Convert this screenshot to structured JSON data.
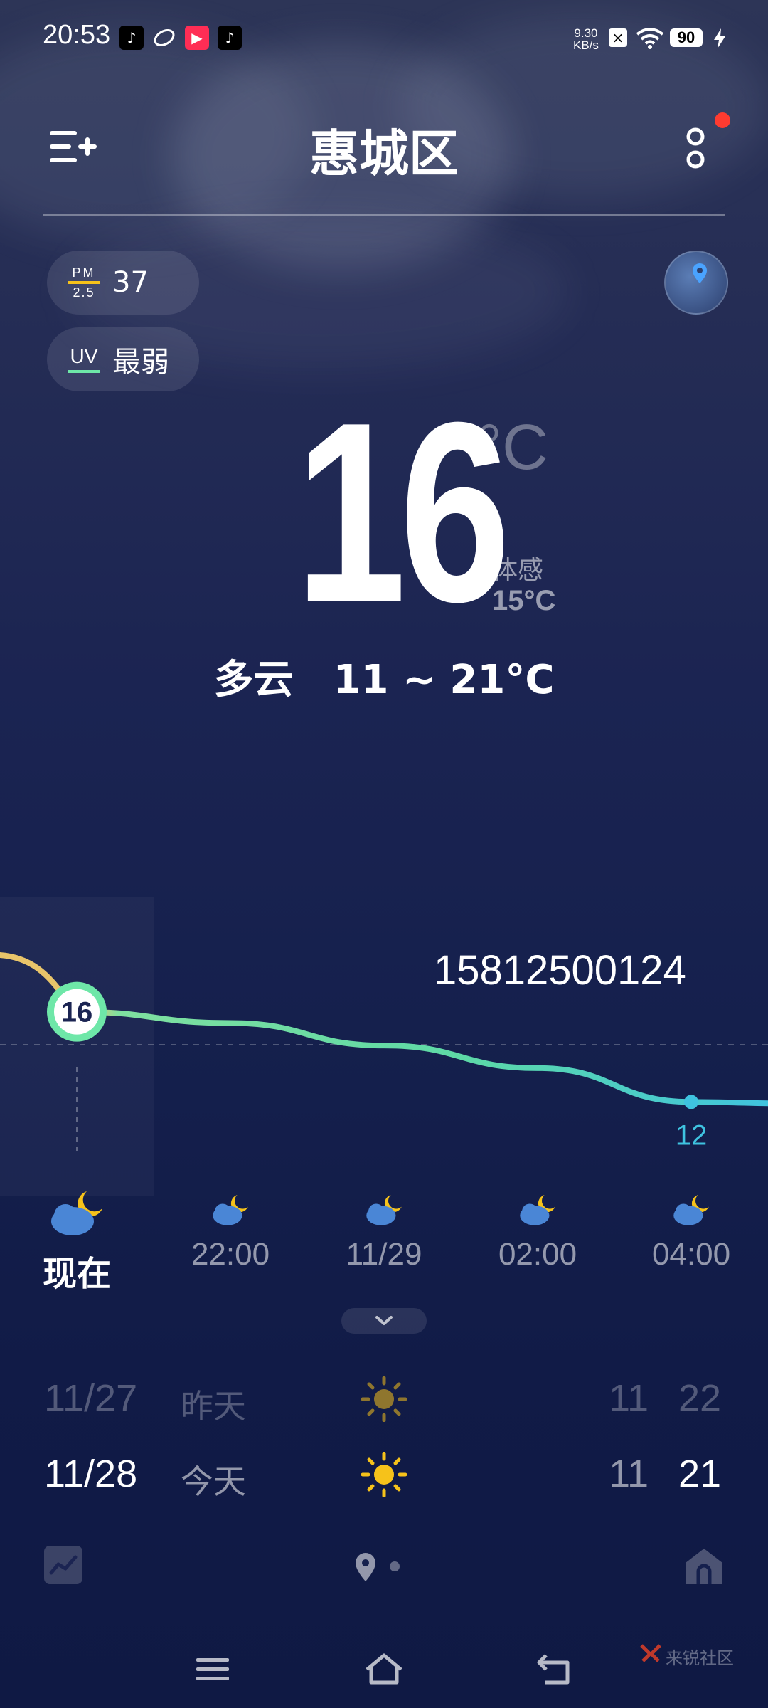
{
  "status_bar": {
    "time": "20:53",
    "network_speed_value": "9.30",
    "network_speed_unit": "KB/s",
    "battery": "90"
  },
  "header": {
    "city": "惠城区"
  },
  "air": {
    "pm_top": "PM",
    "pm_bottom": "2.5",
    "pm_value": "37",
    "uv_label": "UV",
    "uv_value": "最弱"
  },
  "current": {
    "temperature": "16",
    "unit": "°C",
    "feels_label": "体感",
    "feels_value": "15°C",
    "condition_line": "多云　11 ~ 21°C"
  },
  "overlay_text": "15812500124",
  "chart_data": {
    "type": "line",
    "x": [
      "现在",
      "22:00",
      "11/29",
      "02:00",
      "04:00"
    ],
    "values": [
      16,
      15.5,
      14.5,
      13.5,
      12
    ],
    "labels": {
      "start": "16",
      "end": "12"
    }
  },
  "hourly": [
    {
      "label": "现在",
      "icon": "partly-cloudy-night-icon"
    },
    {
      "label": "22:00",
      "icon": "partly-cloudy-night-icon"
    },
    {
      "label": "11/29",
      "icon": "partly-cloudy-night-icon"
    },
    {
      "label": "02:00",
      "icon": "partly-cloudy-night-icon"
    },
    {
      "label": "04:00",
      "icon": "partly-cloudy-night-icon"
    }
  ],
  "daily": [
    {
      "date": "11/27",
      "day": "昨天",
      "icon": "sun-icon",
      "low": "11",
      "high": "22"
    },
    {
      "date": "11/28",
      "day": "今天",
      "icon": "sun-icon",
      "low": "11",
      "high": "21"
    }
  ],
  "watermark": "来锐社区",
  "colors": {
    "accent_green": "#6ee7a8",
    "accent_cyan": "#3fc3e0",
    "sun": "#f6c21a",
    "alert": "#ff3b30"
  }
}
